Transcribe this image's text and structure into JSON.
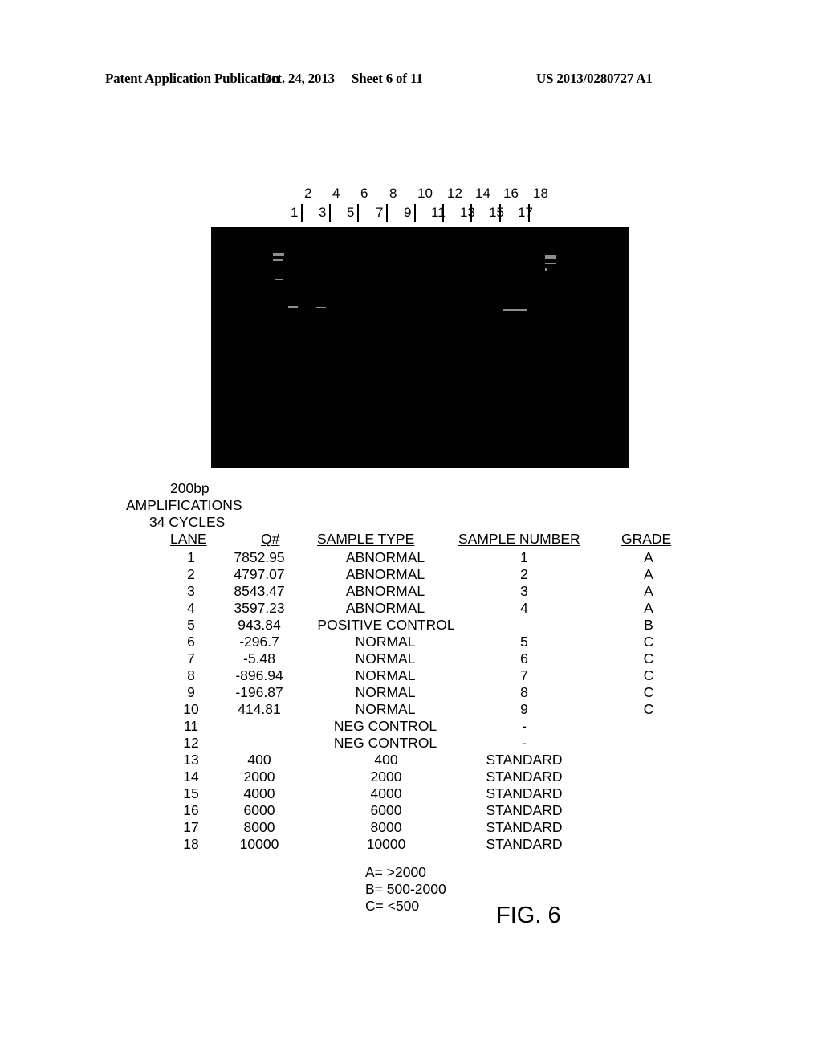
{
  "header": {
    "left": "Patent Application Publication",
    "date": "Oct. 24, 2013",
    "sheet": "Sheet 6 of 11",
    "number": "US 2013/0280727 A1"
  },
  "gel": {
    "lanes_even": [
      "2",
      "4",
      "6",
      "8",
      "10",
      "12",
      "14",
      "16",
      "18"
    ],
    "lanes_odd": [
      "1",
      "3",
      "5",
      "7",
      "9",
      "11",
      "13",
      "15",
      "17"
    ],
    "background_color": "#020202"
  },
  "caption": {
    "line1": "200bp",
    "line2": "AMPLIFICATIONS",
    "line3": "34 CYCLES"
  },
  "table": {
    "headers": [
      "LANE",
      "Q#",
      "SAMPLE TYPE",
      "SAMPLE NUMBER",
      "GRADE"
    ],
    "rows": [
      [
        "1",
        "7852.95",
        "ABNORMAL",
        "1",
        "A"
      ],
      [
        "2",
        "4797.07",
        "ABNORMAL",
        "2",
        "A"
      ],
      [
        "3",
        "8543.47",
        "ABNORMAL",
        "3",
        "A"
      ],
      [
        "4",
        "3597.23",
        "ABNORMAL",
        "4",
        "A"
      ],
      [
        "5",
        "943.84",
        "POSITIVE CONTROL",
        "",
        "B"
      ],
      [
        "6",
        "-296.7",
        "NORMAL",
        "5",
        "C"
      ],
      [
        "7",
        "-5.48",
        "NORMAL",
        "6",
        "C"
      ],
      [
        "8",
        "-896.94",
        "NORMAL",
        "7",
        "C"
      ],
      [
        "9",
        "-196.87",
        "NORMAL",
        "8",
        "C"
      ],
      [
        "10",
        "414.81",
        "NORMAL",
        "9",
        "C"
      ],
      [
        "11",
        "",
        "NEG CONTROL",
        "-",
        ""
      ],
      [
        "12",
        "",
        "NEG CONTROL",
        "-",
        ""
      ],
      [
        "13",
        "400",
        "400",
        "STANDARD",
        ""
      ],
      [
        "14",
        "2000",
        "2000",
        "STANDARD",
        ""
      ],
      [
        "15",
        "4000",
        "4000",
        "STANDARD",
        ""
      ],
      [
        "16",
        "6000",
        "6000",
        "STANDARD",
        ""
      ],
      [
        "17",
        "8000",
        "8000",
        "STANDARD",
        ""
      ],
      [
        "18",
        "10000",
        "10000",
        "STANDARD",
        ""
      ]
    ]
  },
  "legend": {
    "a": "A= >2000",
    "b": "B= 500-2000",
    "c": "C= <500"
  },
  "figure_label": "FIG. 6"
}
